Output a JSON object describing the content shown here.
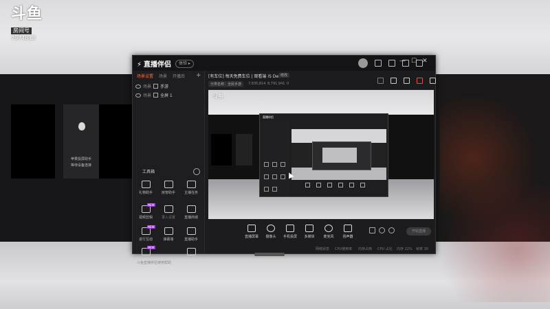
{
  "watermark": {
    "logo": "斗鱼",
    "tag": "房间号",
    "room_number": "7974813"
  },
  "backdrop": {
    "phone_caption": [
      "苹果投屏助手",
      "等待设备连接"
    ]
  },
  "app": {
    "name": "直播伴侣",
    "version_badge": "体验 ▸",
    "window_controls": [
      "—",
      "☐",
      "✕"
    ],
    "toolbar_icons": [
      "message-icon",
      "mail-icon",
      "share-icon",
      "menu-icon"
    ]
  },
  "left_panel": {
    "tabs": [
      "场景设置",
      "场景",
      "开播后"
    ],
    "add_tab": "+",
    "scenes": [
      {
        "visible": true,
        "label_a": "场景",
        "label_b": "手游"
      },
      {
        "visible": true,
        "label_a": "场景",
        "label_b": "全屏 1"
      }
    ],
    "tools_title": "工具箱",
    "tools": [
      {
        "label": "礼物助手",
        "badge": ""
      },
      {
        "label": "房管助手",
        "badge": ""
      },
      {
        "label": "主播任务",
        "badge": ""
      },
      {
        "label": "视频剪辑",
        "badge": "NEW"
      },
      {
        "label": "录入设置",
        "badge": ""
      },
      {
        "label": "直播商城",
        "badge": ""
      },
      {
        "label": "进行互动",
        "badge": "NEW"
      },
      {
        "label": "弹幕墙",
        "badge": ""
      },
      {
        "label": "直播助手",
        "badge": ""
      },
      {
        "label": "游戏助手",
        "badge": "NEW"
      },
      {
        "label": "",
        "badge": ""
      },
      {
        "label": "",
        "badge": ""
      }
    ],
    "footer": "斗鱼直播伴侣使用帮助"
  },
  "main": {
    "room_title": "[有车位] 每天免费车位 | 观看端 iS Demo",
    "edit_button": "修改",
    "category": "分类名称：全民手游",
    "stats": [
      "7,835,814",
      "8,791,941",
      "0"
    ],
    "preview": {
      "logo": "斗鱼",
      "nested_title": "直播伴侣"
    },
    "bottom_bar": [
      {
        "label": "直播屏幕",
        "icon": "screen-icon"
      },
      {
        "label": "摄像头",
        "icon": "camera-icon"
      },
      {
        "label": "手机投屏",
        "icon": "phone-cast-icon"
      },
      {
        "label": "多媒体",
        "icon": "media-icon"
      },
      {
        "label": "麦克风",
        "icon": "microphone-icon"
      },
      {
        "label": "扬声器",
        "icon": "speaker-icon"
      }
    ],
    "start_button": "开始直播",
    "status": [
      "网络状态",
      "CPU使用率",
      "内存占用",
      "CPU 占比",
      "内存 22%",
      "帧率 30"
    ]
  },
  "colors": {
    "accent": "#ff6a3d",
    "badge": "#9b3bd1",
    "window_bg": "#1c1c1e"
  }
}
